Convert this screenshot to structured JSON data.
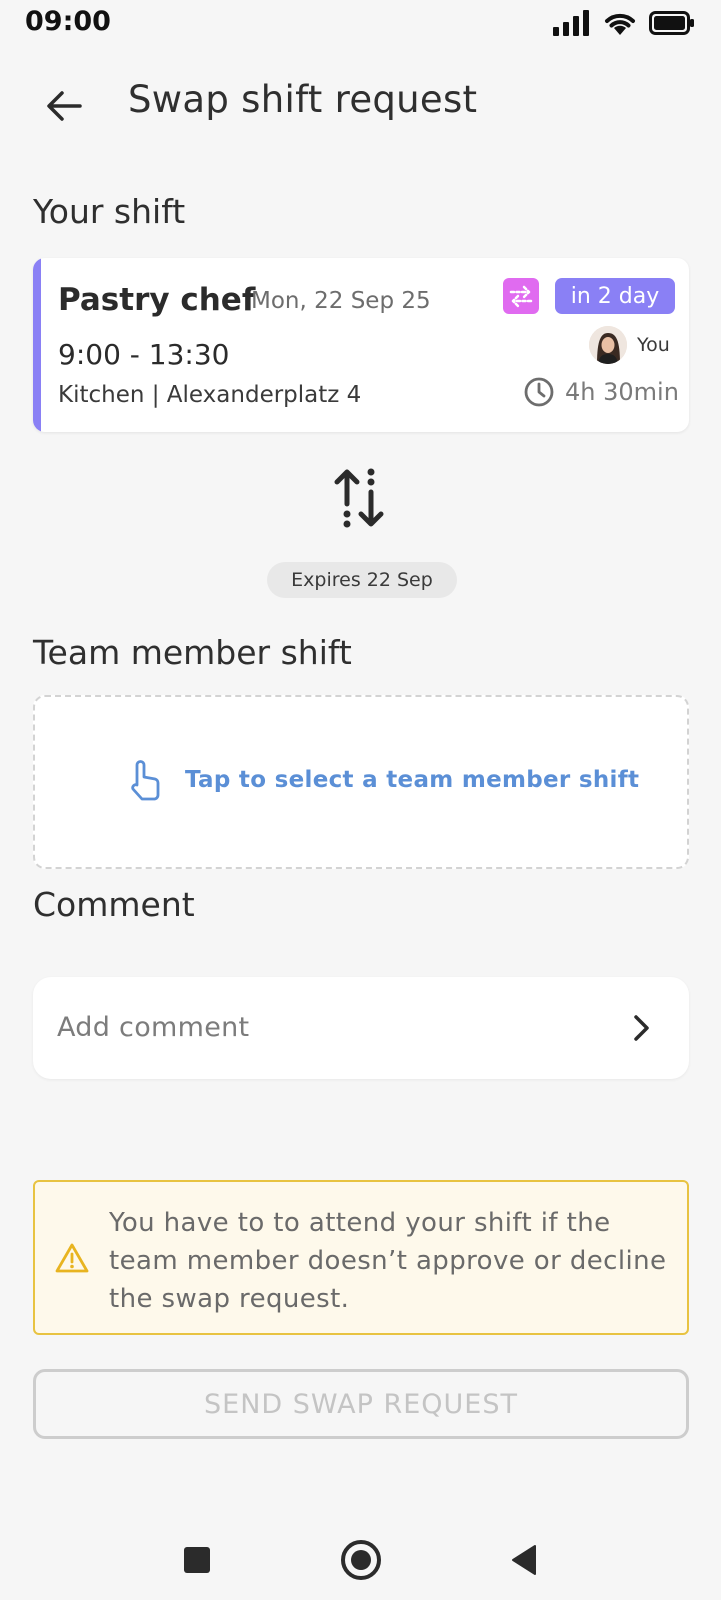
{
  "status_bar": {
    "time": "09:00"
  },
  "header": {
    "title": "Swap shift request"
  },
  "your_shift": {
    "section_title": "Your shift",
    "role": "Pastry chef",
    "date": "Mon, 22 Sep 25",
    "badge": "in 2 day",
    "time_range": "9:00 - 13:30",
    "location": "Kitchen | Alexanderplatz 4",
    "assignee": "You",
    "duration": "4h 30min",
    "accent_color": "#8a80f5",
    "swap_badge_color": "#e06bf0"
  },
  "expires": "Expires 22 Sep",
  "team_member_shift": {
    "section_title": "Team member shift",
    "select_label": "Tap to select a team member shift"
  },
  "comment": {
    "section_title": "Comment",
    "placeholder": "Add comment"
  },
  "warning": {
    "text": "You have to to attend your shift if the team member doesn’t approve or decline the swap request.",
    "border_color": "#e8c341"
  },
  "send_button": {
    "label": "SEND SWAP REQUEST",
    "enabled": false
  },
  "icons": [
    "signal-icon",
    "wifi-icon",
    "battery-icon",
    "back-arrow-icon",
    "swap-icon",
    "clock-icon",
    "swap-arrows-icon",
    "tap-icon",
    "chevron-right-icon",
    "warning-icon",
    "nav-recents-icon",
    "nav-home-icon",
    "nav-back-icon"
  ]
}
